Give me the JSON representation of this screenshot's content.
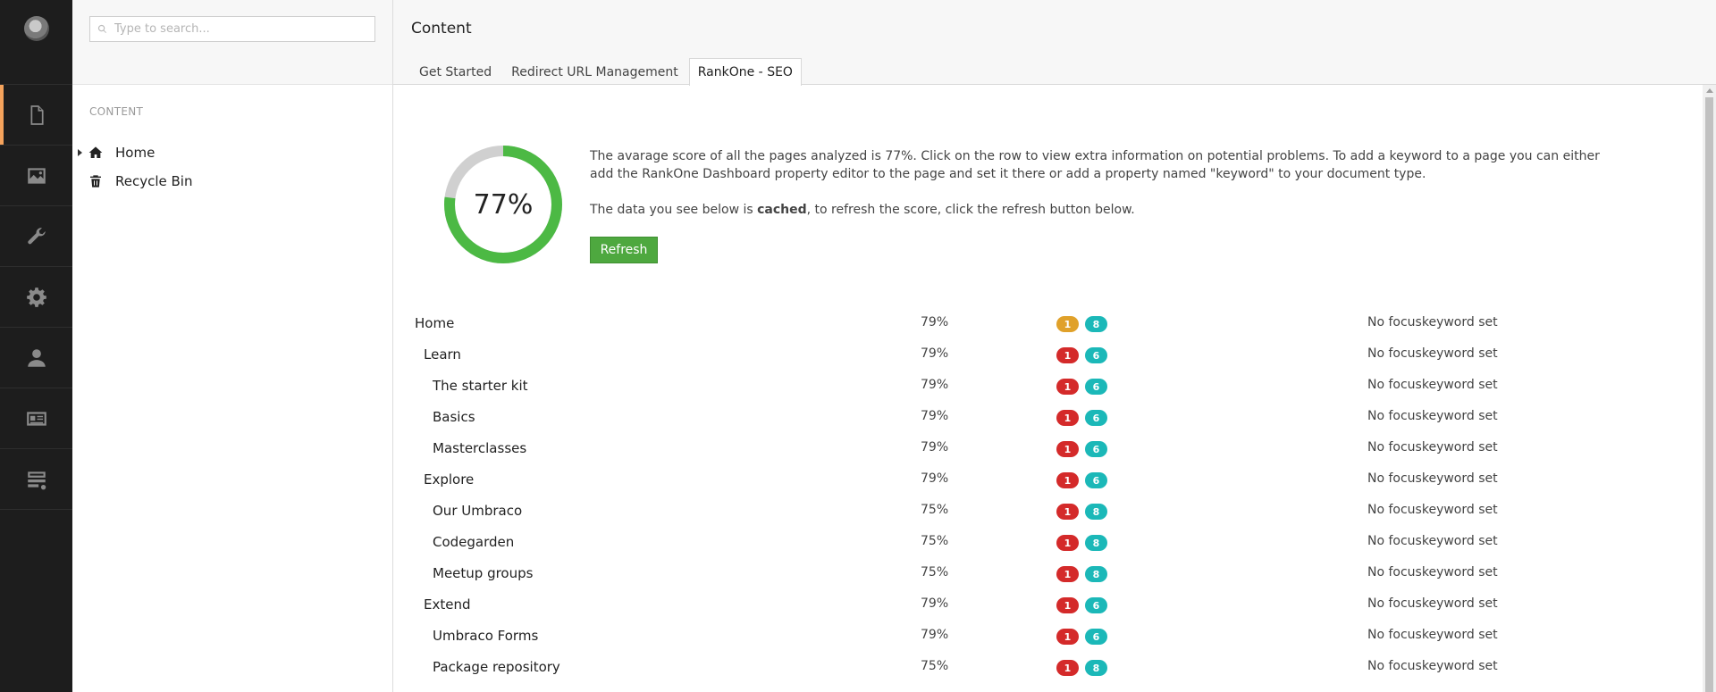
{
  "app_nav": {
    "items": [
      {
        "name": "content-section",
        "icon": "document-icon",
        "active": true
      },
      {
        "name": "media-section",
        "icon": "image-icon",
        "active": false
      },
      {
        "name": "settings-section",
        "icon": "wrench-icon",
        "active": false
      },
      {
        "name": "developer-section",
        "icon": "gear-icon",
        "active": false
      },
      {
        "name": "users-section",
        "icon": "user-icon",
        "active": false
      },
      {
        "name": "members-section",
        "icon": "id-card-icon",
        "active": false
      },
      {
        "name": "forms-section",
        "icon": "form-icon",
        "active": false
      }
    ]
  },
  "tree": {
    "search_placeholder": "Type to search...",
    "section_title": "CONTENT",
    "nodes": [
      {
        "label": "Home",
        "icon": "home-icon",
        "has_children": true
      },
      {
        "label": "Recycle Bin",
        "icon": "trash-icon",
        "has_children": false
      }
    ]
  },
  "main": {
    "title": "Content",
    "tabs": [
      {
        "label": "Get Started",
        "active": false
      },
      {
        "label": "Redirect URL Management",
        "active": false
      },
      {
        "label": "RankOne - SEO",
        "active": true
      }
    ]
  },
  "seo": {
    "score_percent": 77,
    "score_label": "77%",
    "intro_1": "The avarage score of all the pages analyzed is 77%. Click on the row to view extra information on potential problems. To add a keyword to a page you can either add the RankOne Dashboard property editor to the page and set it there or add a property named \"keyword\" to your document type.",
    "intro_2_before": "The data you see below is ",
    "intro_2_bold": "cached",
    "intro_2_after": ", to refresh the score, click the refresh button below.",
    "refresh_label": "Refresh",
    "colors": {
      "score_green": "#4cb944",
      "score_grey": "#d0d0d0",
      "error_red": "#d42a2a",
      "warning_orange": "#e0a12a",
      "info_teal": "#1bb8b8",
      "accent_orange": "#f5a35c"
    },
    "rows": [
      {
        "name": "Home",
        "level": 0,
        "score": "79%",
        "badge1": "1",
        "badge1_type": "warning",
        "badge2": "8",
        "keyword": "No focuskeyword set"
      },
      {
        "name": "Learn",
        "level": 1,
        "score": "79%",
        "badge1": "1",
        "badge1_type": "error",
        "badge2": "6",
        "keyword": "No focuskeyword set"
      },
      {
        "name": "The starter kit",
        "level": 2,
        "score": "79%",
        "badge1": "1",
        "badge1_type": "error",
        "badge2": "6",
        "keyword": "No focuskeyword set"
      },
      {
        "name": "Basics",
        "level": 2,
        "score": "79%",
        "badge1": "1",
        "badge1_type": "error",
        "badge2": "6",
        "keyword": "No focuskeyword set"
      },
      {
        "name": "Masterclasses",
        "level": 2,
        "score": "79%",
        "badge1": "1",
        "badge1_type": "error",
        "badge2": "6",
        "keyword": "No focuskeyword set"
      },
      {
        "name": "Explore",
        "level": 1,
        "score": "79%",
        "badge1": "1",
        "badge1_type": "error",
        "badge2": "6",
        "keyword": "No focuskeyword set"
      },
      {
        "name": "Our Umbraco",
        "level": 2,
        "score": "75%",
        "badge1": "1",
        "badge1_type": "error",
        "badge2": "8",
        "keyword": "No focuskeyword set"
      },
      {
        "name": "Codegarden",
        "level": 2,
        "score": "75%",
        "badge1": "1",
        "badge1_type": "error",
        "badge2": "8",
        "keyword": "No focuskeyword set"
      },
      {
        "name": "Meetup groups",
        "level": 2,
        "score": "75%",
        "badge1": "1",
        "badge1_type": "error",
        "badge2": "8",
        "keyword": "No focuskeyword set"
      },
      {
        "name": "Extend",
        "level": 1,
        "score": "79%",
        "badge1": "1",
        "badge1_type": "error",
        "badge2": "6",
        "keyword": "No focuskeyword set"
      },
      {
        "name": "Umbraco Forms",
        "level": 2,
        "score": "79%",
        "badge1": "1",
        "badge1_type": "error",
        "badge2": "6",
        "keyword": "No focuskeyword set"
      },
      {
        "name": "Package repository",
        "level": 2,
        "score": "75%",
        "badge1": "1",
        "badge1_type": "error",
        "badge2": "8",
        "keyword": "No focuskeyword set"
      }
    ]
  }
}
